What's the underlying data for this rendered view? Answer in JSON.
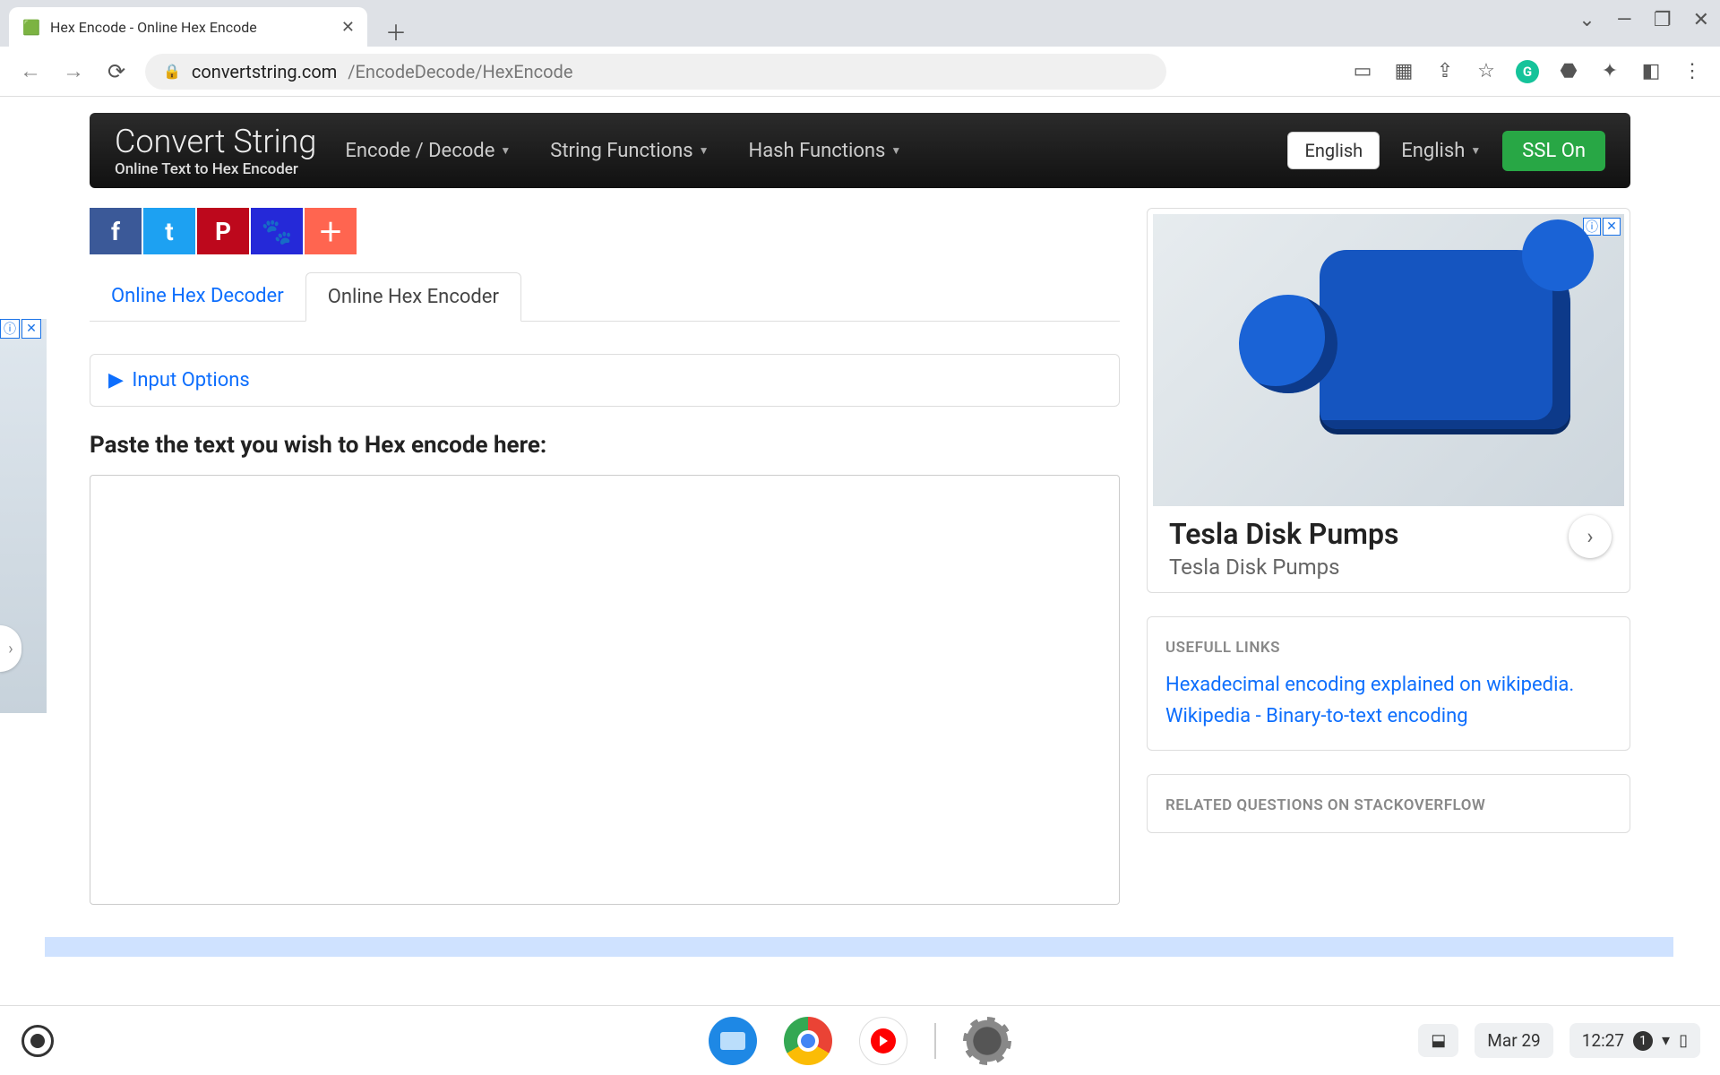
{
  "browser": {
    "tab_title": "Hex Encode - Online Hex Encode",
    "url_domain": "convertstring.com",
    "url_path": "/EncodeDecode/HexEncode"
  },
  "navbar": {
    "brand": "Convert String",
    "subtitle": "Online Text to Hex Encoder",
    "menu1": "Encode / Decode",
    "menu2": "String Functions",
    "menu3": "Hash Functions",
    "lang_btn": "English",
    "lang_drop": "English",
    "ssl": "SSL On"
  },
  "tabs": {
    "decoder": "Online Hex Decoder",
    "encoder": "Online Hex Encoder"
  },
  "input_options": "Input Options",
  "prompt": "Paste the text you wish to Hex encode here:",
  "textarea_value": "",
  "ad": {
    "title": "Tesla Disk Pumps",
    "subtitle": "Tesla Disk Pumps"
  },
  "useful": {
    "heading": "USEFULL LINKS",
    "link1": "Hexadecimal encoding explained on wikipedia.",
    "link2": "Wikipedia - Binary-to-text encoding"
  },
  "stack_heading": "RELATED QUESTIONS ON STACKOVERFLOW",
  "shelf": {
    "date": "Mar 29",
    "time": "12:27",
    "notif": "1"
  }
}
